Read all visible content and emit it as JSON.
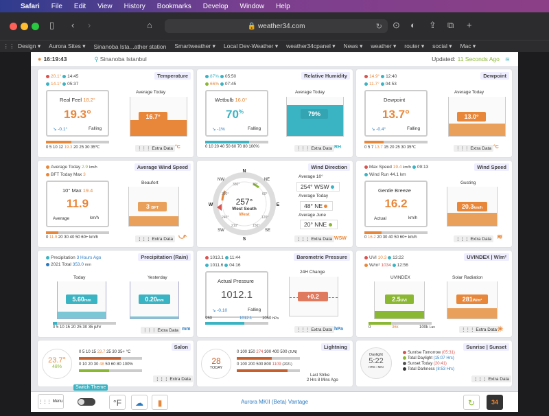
{
  "menubar": {
    "app": "Safari",
    "items": [
      "File",
      "Edit",
      "View",
      "History",
      "Bookmarks",
      "Develop",
      "Window",
      "Help"
    ]
  },
  "browser": {
    "url": "weather34.com"
  },
  "favorites": [
    "Design ▾",
    "Aurora Sites ▾",
    "Sinanoba Ista...ather station",
    "Smartweather ▾",
    "Local Dev-Weather ▾",
    "weather34cpanel ▾",
    "News ▾",
    "weather ▾",
    "router ▾",
    "social ▾",
    "Mac ▾"
  ],
  "header": {
    "time": "16:19:43",
    "location": "Sinanoba Istanbul",
    "updated_prefix": "Updated:",
    "updated_value": "11 Seconds Ago"
  },
  "temperature": {
    "title": "Temperature",
    "max": "20.1°",
    "max_time": "14:45",
    "min": "14.1°",
    "min_time": "05:37",
    "realfeel_label": "Real Feel",
    "realfeel": "18.2°",
    "value": "19.3°",
    "trend": "-0.1°",
    "trend_word": "Falling",
    "avg_label": "Average Today",
    "avg": "16.7°",
    "scale": "0 5 10 12",
    "scale_hi": "19.3",
    "scale_rest": "20 25 30 35℃",
    "extra": "Extra Data",
    "unit": "°C",
    "tank_scale": [
      "40c",
      "35",
      "30",
      "25",
      "20",
      "15",
      "10",
      "5",
      "0"
    ]
  },
  "humidity": {
    "title": "Relative Humidity",
    "max": "87%",
    "max_time": "05:50",
    "min": "66%",
    "min_time": "07:45",
    "label": "Wetbulb",
    "wetbulb": "16.0°",
    "value": "70",
    "unit_sup": "%",
    "trend": "-1%",
    "trend_word": "Falling",
    "avg_label": "Average Today",
    "avg": "79%",
    "scale": "0 10 20 40 50 60 70 80 100%",
    "extra": "Extra Data",
    "unit": "RH",
    "tank_scale": [
      "100%",
      "",
      "",
      "",
      "",
      "",
      "",
      "",
      "0"
    ]
  },
  "dewpoint": {
    "title": "Dewpoint",
    "max": "14.9°",
    "max_time": "12:40",
    "min": "11.7°",
    "min_time": "04:53",
    "label": "Dewpoint",
    "value": "13.7°",
    "trend": "-0.4°",
    "trend_word": "Falling",
    "avg_label": "Average Today",
    "avg": "13.0°",
    "scale": "0 5 7",
    "scale_hi": "13.7",
    "scale_rest": "15 20 25 30 35℃",
    "extra": "Extra Data",
    "unit": "°C",
    "tank_scale": [
      "40c",
      "35",
      "30",
      "25",
      "20",
      "15",
      "10",
      "5",
      "0"
    ]
  },
  "avgwind": {
    "title": "Average Wind Speed",
    "avg_today_label": "Average Today",
    "avg_today": "2.9",
    "avg_unit": "km/h",
    "bft_label": "BFT Today Max",
    "bft": "3",
    "max_label": "10° Max",
    "max": "19.4",
    "value": "11.9",
    "avg_word": "Average",
    "unit": "km/h",
    "beaufort_label": "Beaufort",
    "beaufort": "3",
    "beaufort_unit": "BFT",
    "scale_lo": "0",
    "scale_hi": "11.9",
    "scale_rest": "20 30 40 50 60+",
    "scale_unit": "km/h",
    "extra": "Extra Data",
    "tank_scale": [
      "12BFT",
      "10",
      "8",
      "6",
      "4",
      "2",
      "0"
    ]
  },
  "winddir": {
    "title": "Wind Direction",
    "deg": "257°",
    "word": "West South",
    "word2": "West",
    "avg10_label": "Average 10°",
    "avg10": "254°",
    "avg10_dir": "WSW",
    "today_label": "Average Today",
    "today": "48°",
    "today_dir": "NE",
    "june_label": "Average June",
    "june": "20°",
    "june_dir": "NNE",
    "extra": "Extra Data",
    "unit": "WSW",
    "compass": [
      "N",
      "NE",
      "E",
      "SE",
      "S",
      "SW",
      "W",
      "NW"
    ],
    "ticks": [
      "330°",
      "30°",
      "60°",
      "120°",
      "150°",
      "210°",
      "240°",
      "300°"
    ]
  },
  "windspeed": {
    "title": "Wind Speed",
    "max_label": "Max Speed",
    "max": "19.4",
    "max_unit": "km/h",
    "max_time": "09:13",
    "run_label": "Wind Run",
    "run": "44.1 km",
    "breeze": "Gentle Breeze",
    "value": "16.2",
    "actual": "Actual",
    "unit": "km/h",
    "gust_label": "Gusting",
    "gust": "20.3",
    "gust_unit": "km/h",
    "scale_lo": "0",
    "scale_hi": "16.2",
    "scale_rest": "20 30 40 50 60+",
    "scale_unit": "km/h",
    "extra": "Extra Data",
    "tank_scale": [
      "60km/h",
      "50",
      "40",
      "30",
      "20",
      "10",
      "0"
    ]
  },
  "rain": {
    "title": "Precipitation (Rain)",
    "p_label": "Precipitation",
    "p_ago": "3 Hours Ago",
    "total_label": "2021 Total",
    "total": "353.0",
    "total_unit": "mm",
    "today_label": "Today",
    "today": "5.60",
    "today_unit": "mm",
    "yest_label": "Yesterday",
    "yest": "0.20",
    "yest_unit": "mm",
    "scale": "0 5 10 15 20 25 30 35 p/hr",
    "extra": "Extra Data",
    "unit": "mm",
    "tank_scale": [
      "40mm",
      "35",
      "30",
      "25",
      "20",
      "15",
      "10",
      "5",
      "0"
    ]
  },
  "baro": {
    "title": "Barometric Pressure",
    "max": "1013.1",
    "max_time": "11:44",
    "min": "1011.6",
    "min_time": "04:16",
    "label": "Actual Pressure",
    "value": "1012.1",
    "trend": "-0.10",
    "trend_word": "Falling",
    "change_label": "24H Change",
    "change": "+0.2",
    "scale_lo": "950",
    "scale_mid": "1012.1",
    "scale_hi": "1050",
    "scale_unit": "hPa",
    "extra": "Extra Data",
    "unit": "hPa",
    "tank_scale": [
      "hPa",
      "+10",
      "+5",
      "0",
      "-5",
      "-10"
    ]
  },
  "uv": {
    "title": "UVINDEX | W/m²",
    "uv_label": "UVI",
    "uv": "10.3",
    "uv_time": "13:22",
    "w_label": "W/m²",
    "w": "1034",
    "w_time": "12:56",
    "uvi_label": "UVINDEX",
    "uvi": "2.5",
    "uvi_unit": "UVI",
    "solar_label": "Solar Radiation",
    "solar": "281",
    "solar_unit": "W/m²",
    "scale_lo": "0",
    "scale_mid": "36k",
    "scale_hi": "100k",
    "scale_unit": "Lux",
    "extra": "Extra Data"
  },
  "salon": {
    "title": "Salon",
    "temp": "23.7°",
    "hum": "48",
    "hum_unit": "%",
    "scale1": "0 5 10 15",
    "scale1_hi": "23.7",
    "scale1_rest": "25 30 35+ °C",
    "scale2": "0 10 20 30",
    "scale2_hi": "48",
    "scale2_rest": "50 60 80 100%",
    "extra": "Extra Data"
  },
  "lightning": {
    "title": "Lightning",
    "count": "28",
    "today": "TODAY",
    "scale1": "0 100 150",
    "scale1_hi": "274",
    "scale1_rest": "300 400 500",
    "scale1_unit": "JUN",
    "scale2": "0 100 200 500 800",
    "scale2_hi": "1109",
    "scale2_unit": "2021",
    "last": "Last Strike",
    "last_time": "2 Hrs 8 Mins Ago",
    "extra": "Extra Data"
  },
  "sun": {
    "title": "Sunrise | Sunset",
    "daylight_label": "Daylight",
    "daylight": "5:22",
    "daylight_unit": "HRS : MIN",
    "rise_label": "Sunrise Tomorrow",
    "rise": "(05:31)",
    "total_label": "Total Daylight",
    "total": "(15:07 Hrs)",
    "set_label": "Sunset Today",
    "set": "(20:41)",
    "dark_label": "Total Darkness",
    "dark": "(8:53 Hrs)",
    "extra": "Extra Data"
  },
  "footer": {
    "menu": "Menu",
    "switch": "Switch Theme",
    "unit": "°F",
    "brand": "Aurora MKII (Beta) Vantage",
    "logo": "34"
  },
  "colors": {
    "orange": "#e8873a",
    "teal": "#3ab3c3",
    "green": "#8ab832",
    "red": "#d9534f",
    "blue": "#2a7ac0"
  }
}
